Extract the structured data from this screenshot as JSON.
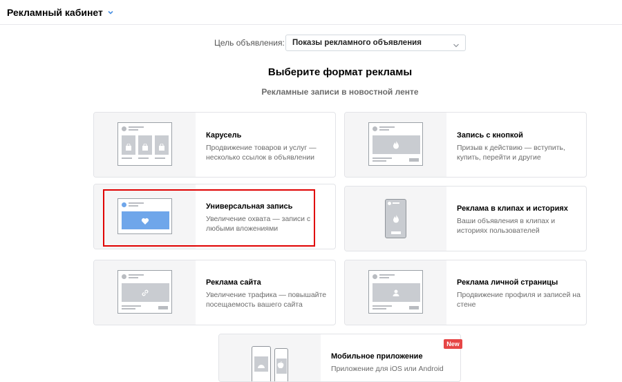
{
  "header": {
    "title": "Рекламный кабинет"
  },
  "goal": {
    "label": "Цель объявления:",
    "value": "Показы рекламного объявления"
  },
  "heading": "Выберите формат рекламы",
  "subheading": "Рекламные записи в новостной ленте",
  "cards": [
    {
      "title": "Карусель",
      "description": "Продвижение товаров и услуг — несколько ссылок в объявлении",
      "preview_icon": "bag-icon"
    },
    {
      "title": "Запись с кнопкой",
      "description": "Призыв к действию — вступить, купить, перейти и другие",
      "preview_icon": "flame-icon"
    },
    {
      "title": "Универсальная запись",
      "description": "Увеличение охвата — записи с любыми вложениями",
      "preview_icon": "heart-icon",
      "highlighted": true
    },
    {
      "title": "Реклама в клипах и историях",
      "description": "Ваши объявления в клипах и историях пользователей",
      "preview_icon": "flame-icon"
    },
    {
      "title": "Реклама сайта",
      "description": "Увеличение трафика — повышайте посещаемость вашего сайта",
      "preview_icon": "link-icon"
    },
    {
      "title": "Реклама личной страницы",
      "description": "Продвижение профиля и записей на стене",
      "preview_icon": "person-icon"
    },
    {
      "title": "Мобильное приложение",
      "description": "Приложение для iOS или Android",
      "preview_icon": "android-apple-icon",
      "badge": "New"
    }
  ],
  "colors": {
    "highlight": "#e00000",
    "badge": "#e64646",
    "accent": "#4a90e2",
    "selected_image": "#6fa6ea"
  }
}
